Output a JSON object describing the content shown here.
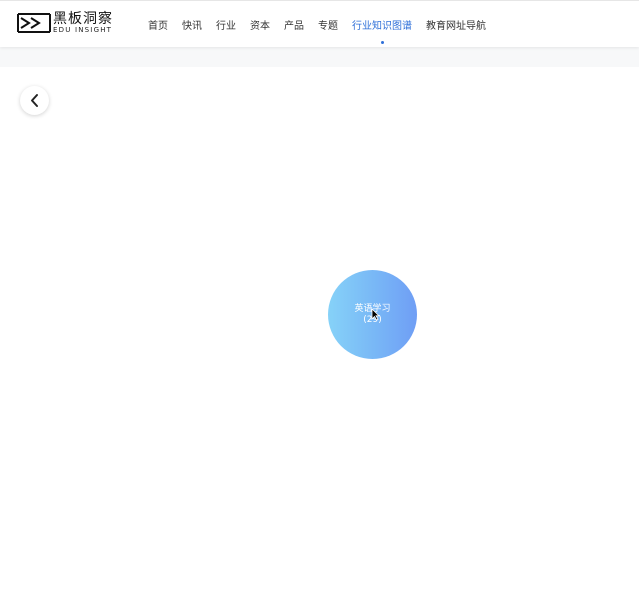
{
  "header": {
    "logo": {
      "name_cn": "黑板洞察",
      "name_en": "EDU INSIGHT"
    },
    "nav": [
      {
        "label": "首页"
      },
      {
        "label": "快讯"
      },
      {
        "label": "行业"
      },
      {
        "label": "资本"
      },
      {
        "label": "产品"
      },
      {
        "label": "专题"
      },
      {
        "label": "行业知识图谱",
        "active": true
      },
      {
        "label": "教育网址导航"
      }
    ]
  },
  "back_button": {
    "icon": "chevron-left-icon"
  },
  "graph": {
    "node": {
      "label": "英语学习",
      "count": "(29)"
    }
  },
  "colors": {
    "accent": "#2e6fd8",
    "node_gradient_start": "#86d2f8",
    "node_gradient_end": "#6f9ef5"
  }
}
